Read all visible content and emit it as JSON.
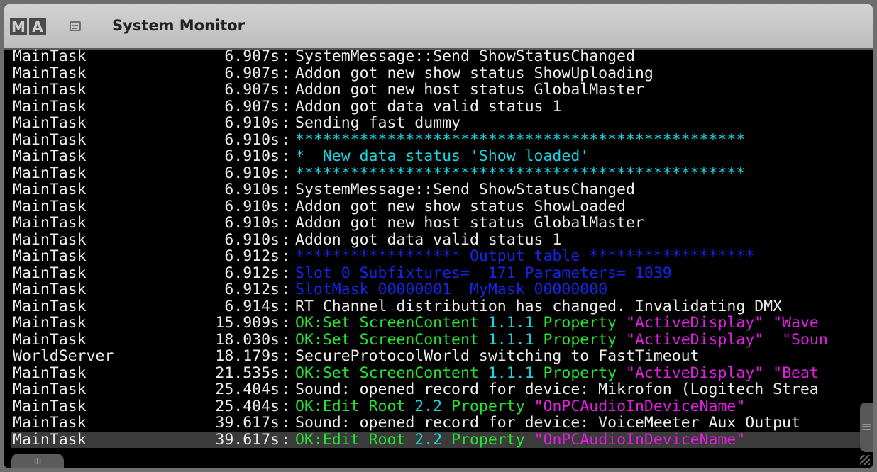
{
  "window": {
    "logo_letters": [
      "M",
      "A"
    ],
    "title": "System Monitor",
    "bottom_tab_label": "III",
    "scroll_handle_label": "≡"
  },
  "colors": {
    "background": "#000000",
    "text": "#ececec",
    "cyan": "#17d7e2",
    "blue": "#1424e8",
    "green": "#22e62e",
    "magenta": "#e21ee2",
    "titlebar": "#c8c8c8"
  },
  "log": {
    "separator": ":",
    "rows": [
      {
        "task": "MainTask",
        "time": "6.907s",
        "msg": "SystemMessage::Send ShowStatusChanged",
        "color": "white"
      },
      {
        "task": "MainTask",
        "time": "6.907s",
        "msg": "Addon got new show status ShowUploading",
        "color": "white"
      },
      {
        "task": "MainTask",
        "time": "6.907s",
        "msg": "Addon got new host status GlobalMaster",
        "color": "white"
      },
      {
        "task": "MainTask",
        "time": "6.907s",
        "msg": "Addon got data valid status 1",
        "color": "white"
      },
      {
        "task": "MainTask",
        "time": "6.910s",
        "msg": "Sending fast dummy",
        "color": "white"
      },
      {
        "task": "MainTask",
        "time": "6.910s",
        "msg": "*************************************************",
        "color": "cyan"
      },
      {
        "task": "MainTask",
        "time": "6.910s",
        "msg": "*  New data status 'Show loaded'",
        "color": "cyan"
      },
      {
        "task": "MainTask",
        "time": "6.910s",
        "msg": "*************************************************",
        "color": "cyan"
      },
      {
        "task": "MainTask",
        "time": "6.910s",
        "msg": "SystemMessage::Send ShowStatusChanged",
        "color": "white"
      },
      {
        "task": "MainTask",
        "time": "6.910s",
        "msg": "Addon got new show status ShowLoaded",
        "color": "white"
      },
      {
        "task": "MainTask",
        "time": "6.910s",
        "msg": "Addon got new host status GlobalMaster",
        "color": "white"
      },
      {
        "task": "MainTask",
        "time": "6.910s",
        "msg": "Addon got data valid status 1",
        "color": "white"
      },
      {
        "task": "MainTask",
        "time": "6.912s",
        "msg": "****************** Output table ******************",
        "color": "blue"
      },
      {
        "task": "MainTask",
        "time": "6.912s",
        "msg": "Slot 0 Subfixtures=  171 Parameters= 1039",
        "color": "blue"
      },
      {
        "task": "MainTask",
        "time": "6.912s",
        "msg": "SlotMask 00000001  MyMask 00000000",
        "color": "blue"
      },
      {
        "task": "MainTask",
        "time": "6.914s",
        "msg": "RT Channel distribution has changed. Invalidating DMX",
        "color": "white"
      },
      {
        "task": "MainTask",
        "time": "15.909s",
        "segments": [
          {
            "t": "OK:",
            "c": "green"
          },
          {
            "t": "Set ScreenContent ",
            "c": "green"
          },
          {
            "t": "1.1.1",
            "c": "cyan"
          },
          {
            "t": " Property ",
            "c": "green"
          },
          {
            "t": "\"ActiveDisplay\" \"Wave",
            "c": "magenta"
          }
        ]
      },
      {
        "task": "MainTask",
        "time": "18.030s",
        "segments": [
          {
            "t": "OK:",
            "c": "green"
          },
          {
            "t": "Set ScreenContent ",
            "c": "green"
          },
          {
            "t": "1.1.1",
            "c": "cyan"
          },
          {
            "t": " Property ",
            "c": "green"
          },
          {
            "t": "\"ActiveDisplay\"  \"Soun",
            "c": "magenta"
          }
        ]
      },
      {
        "task": "WorldServer",
        "time": "18.179s",
        "msg": "SecureProtocolWorld switching to FastTimeout",
        "color": "white"
      },
      {
        "task": "MainTask",
        "time": "21.535s",
        "segments": [
          {
            "t": "OK:",
            "c": "green"
          },
          {
            "t": "Set ScreenContent ",
            "c": "green"
          },
          {
            "t": "1.1.1",
            "c": "cyan"
          },
          {
            "t": " Property ",
            "c": "green"
          },
          {
            "t": "\"ActiveDisplay\" \"Beat",
            "c": "magenta"
          }
        ]
      },
      {
        "task": "MainTask",
        "time": "25.404s",
        "msg": "Sound: opened record for device: Mikrofon (Logitech Strea",
        "color": "white"
      },
      {
        "task": "MainTask",
        "time": "25.404s",
        "segments": [
          {
            "t": "OK:",
            "c": "green"
          },
          {
            "t": "Edit Root ",
            "c": "green"
          },
          {
            "t": "2.2",
            "c": "cyan"
          },
          {
            "t": " Property ",
            "c": "green"
          },
          {
            "t": "\"OnPCAudioInDeviceName\"",
            "c": "magenta"
          }
        ]
      },
      {
        "task": "MainTask",
        "time": "39.617s",
        "msg": "Sound: opened record for device: VoiceMeeter Aux Output",
        "color": "white"
      },
      {
        "task": "MainTask",
        "time": "39.617s",
        "selected": true,
        "segments": [
          {
            "t": "OK:",
            "c": "green"
          },
          {
            "t": "Edit Root ",
            "c": "green"
          },
          {
            "t": "2.2",
            "c": "cyan"
          },
          {
            "t": " Property ",
            "c": "green"
          },
          {
            "t": "\"OnPCAudioInDeviceName\"",
            "c": "magenta"
          }
        ]
      }
    ]
  }
}
